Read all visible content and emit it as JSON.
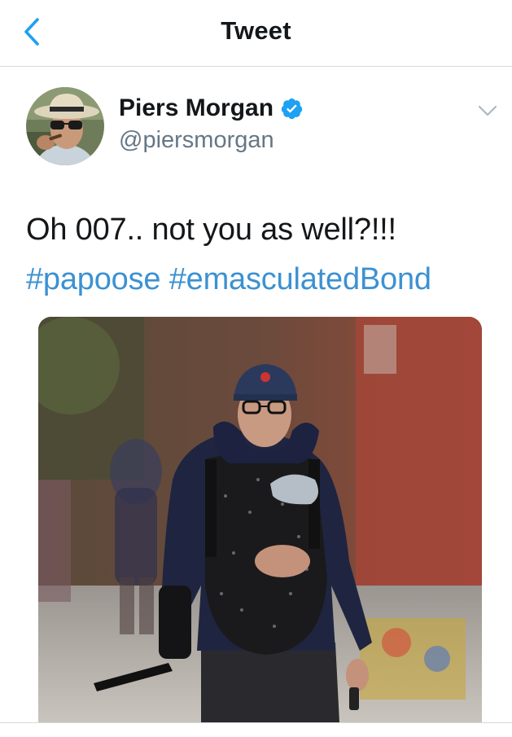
{
  "header": {
    "title": "Tweet",
    "back_icon": "chevron-left-icon"
  },
  "author": {
    "display_name": "Piers Morgan",
    "handle": "@piersmorgan",
    "verified": true,
    "verified_icon": "verified-badge-icon",
    "menu_icon": "chevron-down-icon"
  },
  "tweet": {
    "text": "Oh 007.. not you as well?!!!",
    "hashtags": [
      "#papoose",
      "#emasculatedBond"
    ]
  },
  "media": {
    "type": "photo"
  },
  "colors": {
    "accent": "#1da1f2",
    "hashtag": "#3c91d2",
    "secondary_text": "#657786",
    "divider": "#d6d9db"
  }
}
